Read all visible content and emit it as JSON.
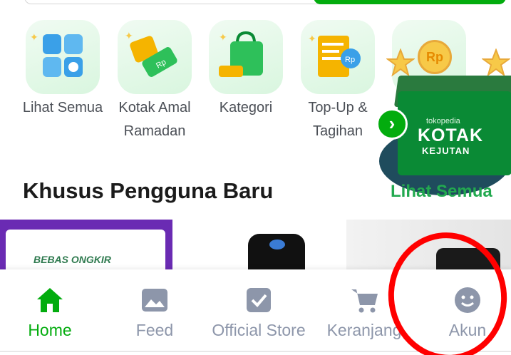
{
  "categories": [
    {
      "label": "Lihat Semua",
      "icon": "grid-icon"
    },
    {
      "label": "Kotak Amal Ramadan",
      "icon": "donation-tag-icon"
    },
    {
      "label": "Kategori",
      "icon": "shopping-bag-icon"
    },
    {
      "label": "Top-Up & Tagihan",
      "icon": "bill-receipt-icon"
    }
  ],
  "promo": {
    "brand": "tokopedia",
    "title": "KOTAK",
    "subtitle": "KEJUTAN",
    "coin_label": "Rp"
  },
  "section": {
    "title": "Khusus Pengguna Baru",
    "see_all": "Lihat Semua"
  },
  "cards": {
    "ongkir_label": "BEBAS ONGKIR"
  },
  "bottom_nav": {
    "items": [
      {
        "label": "Home",
        "icon": "home-icon",
        "active": true
      },
      {
        "label": "Feed",
        "icon": "image-icon",
        "active": false
      },
      {
        "label": "Official Store",
        "icon": "official-store-icon",
        "active": false
      },
      {
        "label": "Keranjang",
        "icon": "cart-icon",
        "active": false
      },
      {
        "label": "Akun",
        "icon": "account-smiley-icon",
        "active": false
      }
    ]
  },
  "colors": {
    "brand_green": "#03ac0e",
    "muted_gray": "#8d96aa",
    "annotation_red": "#ff0000"
  }
}
